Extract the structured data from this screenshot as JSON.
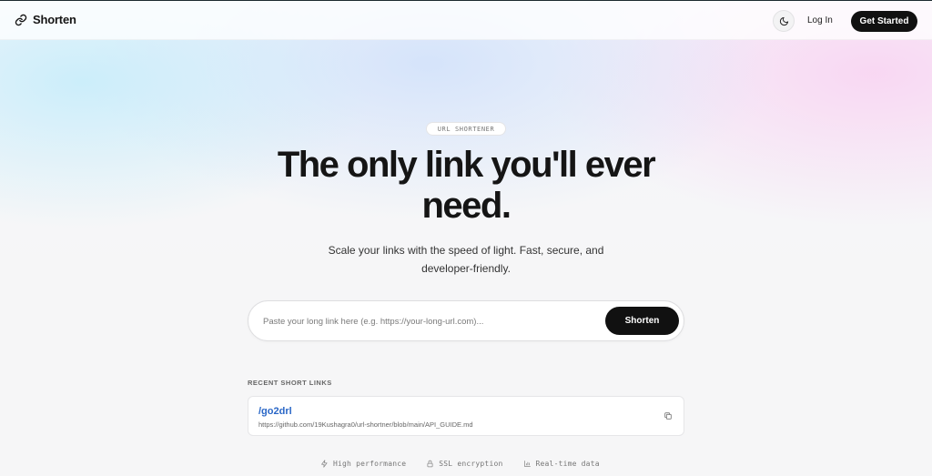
{
  "header": {
    "brand": "Shorten",
    "login": "Log In",
    "get_started": "Get Started"
  },
  "hero": {
    "badge": "URL SHORTENER",
    "headline_line1": "The only link you'll ever",
    "headline_line2": "need.",
    "subtitle_line1": "Scale your links with the speed of light. Fast, secure, and",
    "subtitle_line2": "developer-friendly."
  },
  "search": {
    "placeholder": "Paste your long link here (e.g. https://your-long-url.com)...",
    "value": "",
    "button": "Shorten"
  },
  "recent": {
    "title": "RECENT SHORT LINKS",
    "items": [
      {
        "short": "/go2drl",
        "long": "https://github.com/19Kushagra0/url-shortner/blob/main/API_GUIDE.md"
      }
    ]
  },
  "features": [
    {
      "label": "High performance",
      "icon": "bolt-icon"
    },
    {
      "label": "SSL encryption",
      "icon": "lock-icon"
    },
    {
      "label": "Real-time data",
      "icon": "chart-icon"
    }
  ],
  "colors": {
    "accent_dark": "#111111",
    "link_blue": "#2a67c7",
    "background": "#f6f6f7"
  }
}
